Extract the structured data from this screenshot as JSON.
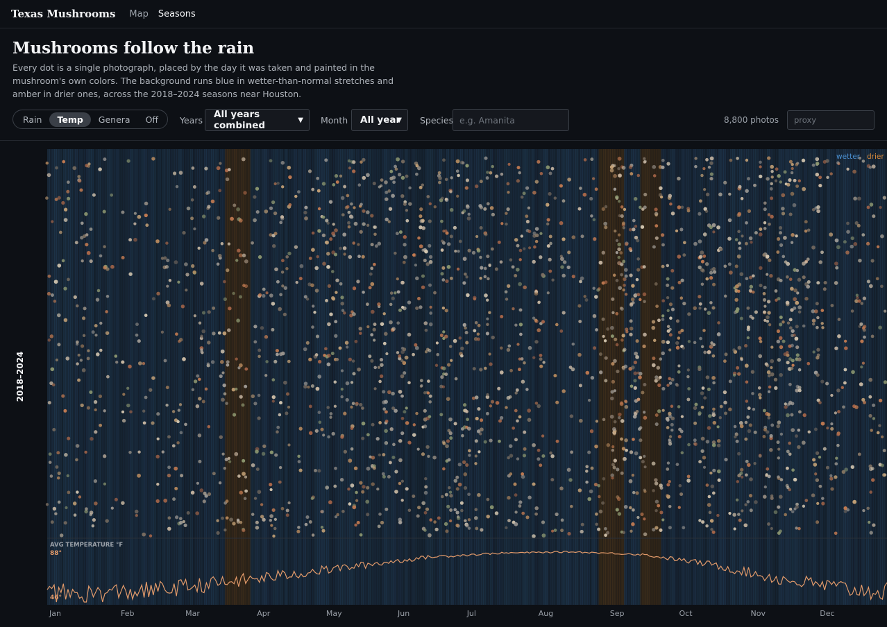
{
  "nav": {
    "brand": "Texas Mushrooms",
    "links": [
      "Map",
      "Seasons"
    ],
    "active": "Seasons"
  },
  "page": {
    "title": "Mushrooms follow the rain",
    "description": "Every dot is a single photograph, placed by the day it was taken and painted in the mushroom's own colors. The background runs blue in wetter-than-normal stretches and amber in drier ones, across the 2018–2024 seasons near Houston."
  },
  "controls": {
    "mode_options": [
      "Rain",
      "Temp",
      "Genera",
      "Off"
    ],
    "mode_selected": "Temp",
    "years_label": "Years",
    "years_value": "All years combined",
    "month_label": "Month",
    "month_value": "All year",
    "species_label": "Species",
    "species_placeholder": "e.g. Amanita",
    "photo_count": "8,800 photos",
    "proxy_placeholder": "proxy"
  },
  "colors": {
    "background": "#0d1015",
    "wetter": "#2a4f73",
    "drier": "#6b4a20",
    "temp_line": "#e29a6a",
    "legend_wetter": "#4a8fd0",
    "legend_drier": "#d98a3a"
  },
  "chart_data": [
    {
      "type": "scatter",
      "ylabel": "2018–2024",
      "x_axis": "day of year",
      "xlim": [
        1,
        365
      ],
      "legend": [
        "wetter",
        "drier"
      ],
      "legend_position": "top-right",
      "total_points": 8800,
      "monthly_density_relative": {
        "Jan": 0.45,
        "Feb": 0.4,
        "Mar": 0.45,
        "Apr": 0.55,
        "May": 0.65,
        "Jun": 0.75,
        "Jul": 0.7,
        "Aug": 0.5,
        "Sep": 0.95,
        "Oct": 1.0,
        "Nov": 0.95,
        "Dec": 0.6
      },
      "dry_periods_day_of_year": [
        [
          78,
          88
        ],
        [
          240,
          250
        ],
        [
          258,
          266
        ]
      ]
    },
    {
      "type": "line",
      "title": "AVG TEMPERATURE °F",
      "x_axis": "day of year",
      "ylim": [
        46,
        88
      ],
      "y_ticks": [
        "88°",
        "46°"
      ],
      "x_ticks": [
        "Jan",
        "Feb",
        "Mar",
        "Apr",
        "May",
        "Jun",
        "Jul",
        "Aug",
        "Sep",
        "Oct",
        "Nov",
        "Dec"
      ],
      "approx_monthly_avg_f": [
        52,
        55,
        61,
        68,
        75,
        82,
        85,
        86,
        84,
        76,
        64,
        56
      ]
    }
  ]
}
